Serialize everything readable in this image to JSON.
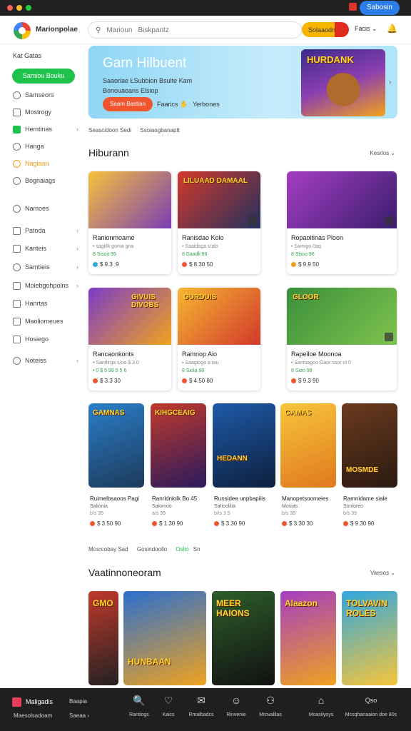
{
  "titlebar": {
    "button": "Sabosin"
  },
  "header": {
    "brand": "Marionpolae",
    "search_placeholder": "Marioun",
    "search_hint": "Biskpantz",
    "pill_label": "Solaaodn",
    "menu_label": "Facis",
    "menu_chevron": "⌄",
    "bell": "🔔"
  },
  "sidebar": {
    "heading": "Kat Gatas",
    "cta": "Samiou Bouku",
    "items": [
      {
        "label": "Samseors",
        "chev": ""
      },
      {
        "label": "Mostrogy",
        "chev": ""
      },
      {
        "label": "Hemtinas",
        "chev": "›"
      },
      {
        "label": "Hanga",
        "chev": ""
      },
      {
        "label": "Nagiaan",
        "chev": ""
      },
      {
        "label": "Bognaiags",
        "chev": ""
      },
      {
        "label": "Namoes",
        "chev": ""
      },
      {
        "label": "Patoda",
        "chev": "›"
      },
      {
        "label": "Kanteis",
        "chev": "›"
      },
      {
        "label": "Samtieis",
        "chev": "›"
      },
      {
        "label": "Moiebgohpolns",
        "chev": "›"
      },
      {
        "label": "Hanrtas",
        "chev": ""
      },
      {
        "label": "Maoliomeues",
        "chev": ""
      },
      {
        "label": "Hosiego",
        "chev": ""
      },
      {
        "label": "Noteiss",
        "chev": "›"
      }
    ]
  },
  "hero": {
    "title": "Garn Hilbuent",
    "line1": "Saaoriae ŁSubbion  Bsulte  Kam",
    "line2": "Bonouaoans Elsiop",
    "button": "Saam Bastian",
    "link1": "Faarics",
    "link1_icon": "✋",
    "link2": "Yerbones",
    "art_label": "HURDANK",
    "arrow": "›"
  },
  "breadcrumb": [
    "Seascidoon Sedi",
    "Ssoiaogbanaptt"
  ],
  "section1": {
    "title": "Hiburann",
    "more": "Kesrlos ⌄"
  },
  "row1": [
    {
      "title": "Ranionmoame",
      "meta1": "• sagtilk goma gna",
      "meta2": "8 Sisoo 95",
      "price": "$ 9.3 :9",
      "thumb_label": "",
      "c1": "#f6c23a",
      "c2": "#7a3db5",
      "dot": "#2ea7e0"
    },
    {
      "title": "Ranisdao Kolo",
      "meta1": "• Saaidaga s/alo",
      "meta2": "8 Daadli 96",
      "price": "$ 8.30 50",
      "thumb_label": "LILUAAD DAMAAL",
      "c1": "#d2392b",
      "c2": "#23305e",
      "dot": "#f0552f"
    },
    {
      "title": "Ropaoitinas Ploon",
      "meta1": "• Samigo 0aq",
      "meta2": "8 Sisso 96",
      "price": "$ 9.9 50",
      "thumb_label": "",
      "c1": "#a43ec2",
      "c2": "#3a1d6e",
      "dot": "#f39a1e"
    }
  ],
  "row2": [
    {
      "title": "Rancaonkonts",
      "meta1": "• Santlirga s/oo $ 3.0",
      "meta2": "• 0 $ 5 99 5 5 6",
      "price": "$ 3.3 30",
      "thumb_label": "GIVUIS DIVOBS",
      "c1": "#7c3cc7",
      "c2": "#f0a21e",
      "dot": "#f0552f"
    },
    {
      "title": "Ramnop Aio",
      "meta1": "• Saagiogo a tau",
      "meta2": "8 Siola 98",
      "price": "$ 4.50 80",
      "thumb_label": "GURDUIS",
      "c1": "#f5b731",
      "c2": "#d2392b",
      "dot": "#f0552f"
    },
    {
      "title": "Rapeiloe Moonoa",
      "meta1": "• Santsagoo Gaor ssor ol 0",
      "meta2": "8 Sioo 98",
      "price": "$ 9.3 90",
      "thumb_label": "GLOOR",
      "c1": "#3a8f3a",
      "c2": "#7fc34f",
      "dot": "#f0552f"
    }
  ],
  "row3": [
    {
      "title": "Ruimelbsaoos Pagi",
      "meta1": "Salionia",
      "meta1b": "b/s 35",
      "price": "$ 3.50 90",
      "thumb_label": "GAMNAS",
      "c1": "#2a7ec9",
      "c2": "#1d3a5a",
      "dot": "#f0552f"
    },
    {
      "title": "Ranrldnlolk Bo 45",
      "meta1": "Salomoo",
      "meta1b": "a/s 39",
      "price": "$ 1.30 90",
      "thumb_label": "KIHGCEAIG",
      "c1": "#c0392b",
      "c2": "#2a1a5e",
      "dot": "#f0552f"
    },
    {
      "title": "Runsidee unpbapiiis",
      "meta1": "Safioolilia",
      "meta1b": "b/is 3 5",
      "price": "$ 3.30 90",
      "thumb_label": "HEDANN",
      "c1": "#1e5aa8",
      "c2": "#0d1f3d",
      "dot": "#f0552f"
    },
    {
      "title": "Manopetsoomeies",
      "meta1": "Mosias",
      "meta1b": "b/s 38",
      "price": "$ 3.30 30",
      "thumb_label": "GAMAS",
      "c1": "#f7c53a",
      "c2": "#e0791e",
      "dot": "#f0552f"
    },
    {
      "title": "Ramnidame siale",
      "meta1": "Sonloreo",
      "meta1b": "b/s 39",
      "price": "$ 9.30 90",
      "thumb_label": "MOSMDE",
      "c1": "#6b3a1e",
      "c2": "#2a1a10",
      "dot": "#f0552f"
    }
  ],
  "crumb2": [
    "Mosrcobay Sad",
    "Gosindoollo",
    "Oslio",
    "Sn"
  ],
  "section2": {
    "title": "Vaatinnoneoram",
    "more": "Vaesos ⌄"
  },
  "row4": [
    {
      "thumb_label": "GMO",
      "c1": "#c0392b",
      "c2": "#222"
    },
    {
      "thumb_label": "HUNBAAN",
      "c1": "#2a6fd0",
      "c2": "#f0a21e"
    },
    {
      "thumb_label": "MEER HAIONS",
      "c1": "#2d5e2a",
      "c2": "#111"
    },
    {
      "thumb_label": "Alaazon",
      "c1": "#a43ec2",
      "c2": "#f0a21e"
    },
    {
      "thumb_label": "TOLVAVIN ROLES",
      "c1": "#2ea7e0",
      "c2": "#f7c53a"
    }
  ],
  "bottombar": {
    "brand": "Maligadis",
    "sub": "Maesolsadoam",
    "col2": "Baapia",
    "col2b": "Saeaa ›",
    "items": [
      {
        "icon": "🔍",
        "label": "Rantiogs"
      },
      {
        "icon": "♡",
        "label": "Kaics"
      },
      {
        "icon": "✉",
        "label": "Rmalbadcs"
      },
      {
        "icon": "☺",
        "label": "Rinvenie"
      },
      {
        "icon": "⚇",
        "label": "Mrovalilas"
      },
      {
        "icon": "⌂",
        "label": "Moasiiyoys"
      },
      {
        "icon": "Qso",
        "label": "Mcsqhanaaion doe 80s"
      }
    ]
  },
  "colors": {
    "accent_green": "#1fc24a",
    "accent_orange": "#f0552f",
    "brand_blue": "#2b7de9"
  }
}
